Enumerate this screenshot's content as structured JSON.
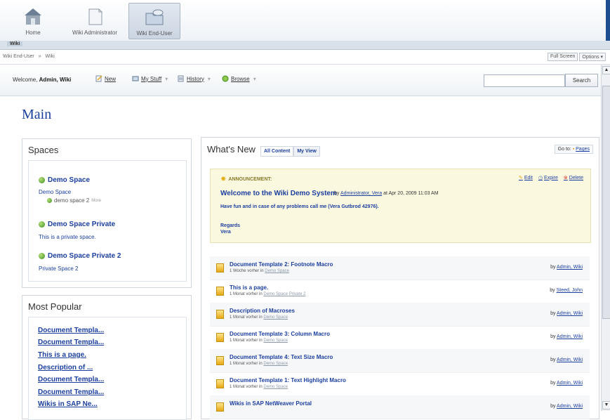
{
  "launcher": {
    "items": [
      {
        "label": "Home",
        "icon": "home-icon"
      },
      {
        "label": "Wiki Administrator",
        "icon": "document-icon"
      },
      {
        "label": "Wiki End-User",
        "icon": "folder-icon"
      }
    ],
    "active_index": 2
  },
  "tabstrip": {
    "label": "Wiki"
  },
  "breadcrumb": {
    "items": [
      "Wiki End-User",
      "»",
      "Wiki"
    ],
    "full_screen": "Full Screen",
    "options": "Options ▾"
  },
  "toolbar": {
    "welcome_prefix": "Welcome,",
    "welcome_user": "Admin, Wiki",
    "items": [
      {
        "label": "New",
        "icon": "new-page-icon"
      },
      {
        "label": "My Stuff",
        "icon": "my-stuff-icon"
      },
      {
        "label": "History",
        "icon": "history-icon"
      },
      {
        "label": "Browse",
        "icon": "browse-icon"
      }
    ],
    "search_value": "",
    "search_label": "Search"
  },
  "page": {
    "title": "Main"
  },
  "spaces": {
    "title": "Spaces",
    "items": [
      {
        "name": "Demo Space",
        "desc": "Demo Space",
        "sub": "demo space 2",
        "more": "More"
      },
      {
        "name": "Demo Space Private",
        "desc": "This is a private space."
      },
      {
        "name": "Demo Space Private 2",
        "desc": "Private Space 2"
      }
    ]
  },
  "popular": {
    "title": "Most Popular",
    "items": [
      "Document Templa...",
      "Document Templa...",
      "This is a page.",
      "Description of ...",
      "Document Templa...",
      "Document Templa...",
      "Wikis in SAP Ne..."
    ]
  },
  "whatsnew": {
    "title": "What's New",
    "tabs": [
      "All Content",
      "My View"
    ],
    "goto_label": "Go to:",
    "goto_link": "Pages",
    "announcement": {
      "label": "ANNOUNCEMENT:",
      "actions": [
        "Edit",
        "Expire",
        "Delete"
      ],
      "title": "Welcome to the Wiki Demo System",
      "by_prefix": "by",
      "author": "Administrator, Vera",
      "date": "at Apr 20, 2009 11:03 AM",
      "body": "Have fun and in case of any problems call me (Vera Gutbrod 42976).",
      "regards": "Regards",
      "signature": "Vera"
    },
    "docs": [
      {
        "title": "Document Template 2: Footnote Macro",
        "time": "1 Woche vorher",
        "in": "in",
        "space": "Demo Space",
        "by": "by",
        "author": "Admin, Wiki"
      },
      {
        "title": "This is a page.",
        "time": "1 Monat vorher",
        "in": "in",
        "space": "Demo Space Private 2",
        "by": "by",
        "author": "Steed, John"
      },
      {
        "title": "Description of Macroses",
        "time": "1 Monat vorher",
        "in": "in",
        "space": "Demo Space",
        "by": "by",
        "author": "Admin, Wiki"
      },
      {
        "title": "Document Template 3: Column Macro",
        "time": "1 Monat vorher",
        "in": "in",
        "space": "Demo Space",
        "by": "by",
        "author": "Admin, Wiki"
      },
      {
        "title": "Document Template 4: Text Size Macro",
        "time": "1 Monat vorher",
        "in": "in",
        "space": "Demo Space",
        "by": "by",
        "author": "Admin, Wiki"
      },
      {
        "title": "Document Template 1: Text Highlight Macro",
        "time": "1 Monat vorher",
        "in": "in",
        "space": "Demo Space",
        "by": "by",
        "author": "Admin, Wiki"
      },
      {
        "title": "Wikis in SAP NetWeaver Portal",
        "time": "",
        "in": "",
        "space": "",
        "by": "by",
        "author": "Admin, Wiki"
      }
    ]
  },
  "colors": {
    "link": "#1b3f9f",
    "announcement_bg": "#fbf8e0",
    "brand": "#1d4e8f"
  }
}
